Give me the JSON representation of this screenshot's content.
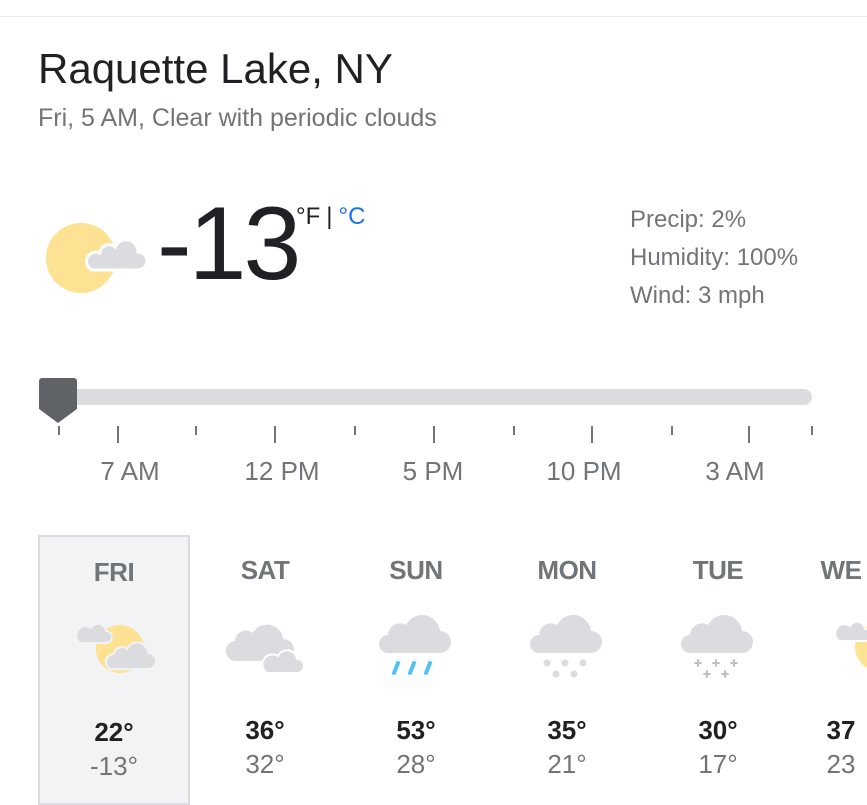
{
  "location": {
    "title": "Raquette Lake, NY",
    "subtitle": "Fri, 5 AM, Clear with periodic clouds"
  },
  "current": {
    "temperature": "-13",
    "icon": "sun-partly-cloudy-icon",
    "unit_f": "°F",
    "unit_separator": "|",
    "unit_c": "°C",
    "precip": "Precip: 2%",
    "humidity": "Humidity: 100%",
    "wind": "Wind: 3 mph"
  },
  "timeline": {
    "labels": [
      "7 AM",
      "12 PM",
      "5 PM",
      "10 PM",
      "3 AM"
    ],
    "slider_position": 0
  },
  "forecast": [
    {
      "day": "FRI",
      "high": "22°",
      "low": "-13°",
      "icon": "partly-sunny-icon",
      "selected": true
    },
    {
      "day": "SAT",
      "high": "36°",
      "low": "32°",
      "icon": "cloudy-icon"
    },
    {
      "day": "SUN",
      "high": "53°",
      "low": "28°",
      "icon": "rain-icon"
    },
    {
      "day": "MON",
      "high": "35°",
      "low": "21°",
      "icon": "snow-icon"
    },
    {
      "day": "TUE",
      "high": "30°",
      "low": "17°",
      "icon": "light-snow-icon"
    },
    {
      "day": "WE",
      "high": "37",
      "low": "23",
      "icon": "partly-sunny-icon"
    }
  ],
  "colors": {
    "accent": "#1a73e8",
    "sun": "#fde293",
    "cloud": "#dadce0",
    "rain": "#4fc3f7",
    "selected_bg": "#f1f3f4",
    "secondary_text": "#70757a"
  }
}
